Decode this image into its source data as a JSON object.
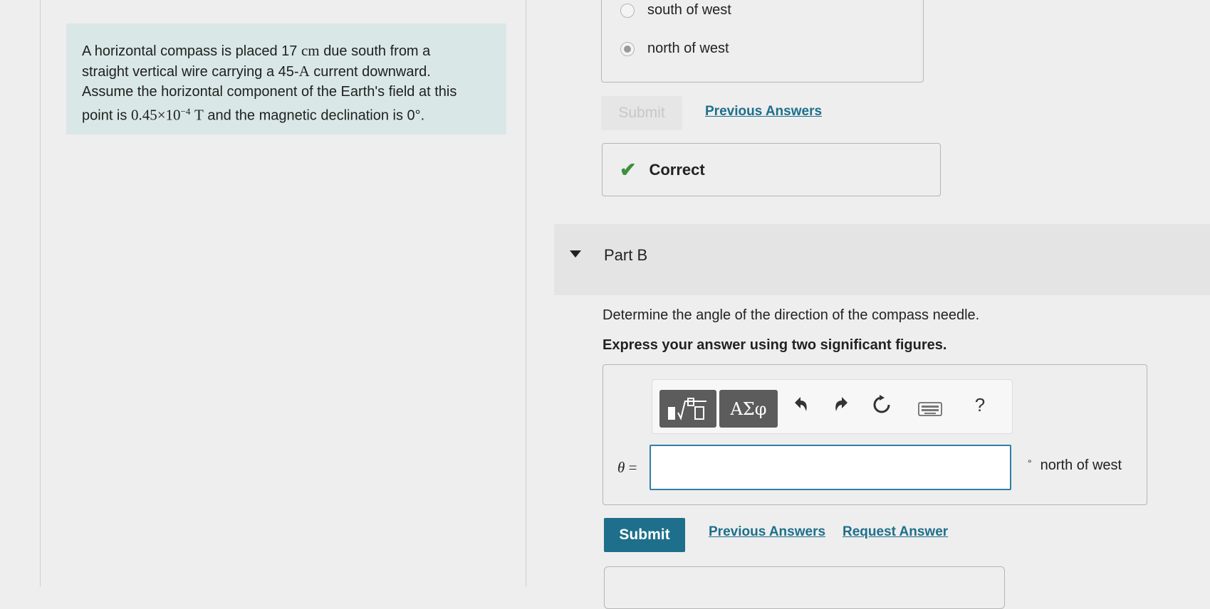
{
  "problem": {
    "line1_a": "A horizontal compass is placed 17",
    "line1_unit": "cm",
    "line1_b": "due south from a",
    "line2_a": "straight vertical wire carrying a 45-",
    "line2_unit": "A",
    "line2_b": "current downward.",
    "line3": "Assume the horizontal component of the Earth's field at this",
    "line4_a": "point is",
    "line4_value": "0.45×10",
    "line4_exp": "−4",
    "line4_unit": "T",
    "line4_b": "and the magnetic declination is",
    "line4_deg": "0°."
  },
  "part_a": {
    "choices": [
      {
        "label": "south of west",
        "selected": false
      },
      {
        "label": "north of west",
        "selected": true
      }
    ],
    "submit_label": "Submit",
    "previous_answers": "Previous Answers",
    "result": "Correct"
  },
  "part_b": {
    "title": "Part B",
    "prompt": "Determine the angle of the direction of the compass needle.",
    "instruction": "Express your answer using two significant figures.",
    "toolbar": {
      "templates_icon": "▮√▯",
      "symbols_label": "ΑΣφ",
      "undo_icon": "undo-icon",
      "redo_icon": "redo-icon",
      "reset_icon": "reset-icon",
      "keyboard_icon": "keyboard-icon",
      "help_label": "?"
    },
    "variable": "θ",
    "equals": "=",
    "answer_value": "",
    "unit_degree": "°",
    "unit_label": "north of west",
    "submit_label": "Submit",
    "previous_answers": "Previous Answers",
    "request_answer": "Request Answer"
  },
  "colors": {
    "accent": "#1d6f8b",
    "problem_bg": "#d9e8e6",
    "correct_check": "#3e8f3e"
  }
}
